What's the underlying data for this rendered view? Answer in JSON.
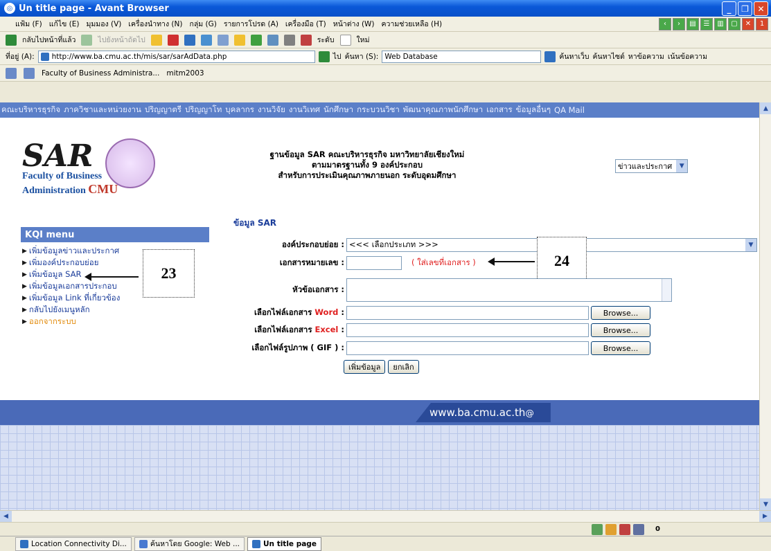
{
  "window": {
    "title": "Un title page - Avant Browser"
  },
  "menu": [
    "แฟ้ม (F)",
    "แก้ไข (E)",
    "มุมมอง (V)",
    "เครื่องนำทาง (N)",
    "กลุ่ม (G)",
    "รายการโปรด (A)",
    "เครื่องมือ (T)",
    "หน้าต่าง (W)",
    "ความช่วยเหลือ (H)"
  ],
  "toolbar": {
    "back": "กลับไปหน้าที่แล้ว",
    "forward": "ไปยังหน้าถัดไป",
    "level": "ระดับ",
    "new": "ใหม่"
  },
  "address": {
    "label": "ที่อยู่ (A):",
    "url": "http://www.ba.cmu.ac.th/mis/sar/sarAdData.php",
    "go": "ไป",
    "search_label": "ค้นหา (S):",
    "search_value": "Web Database",
    "web_search": "ค้นหาเว็บ",
    "site_search": "ค้นหาไซต์",
    "find_text": "หาข้อความ",
    "highlight": "เน้นข้อความ"
  },
  "favorites": [
    "Faculty of Business Administra...",
    "mitm2003"
  ],
  "site_nav": [
    "คณะบริหารธุรกิจ",
    "ภาควิชาและหน่วยงาน",
    "ปริญญาตรี",
    "ปริญญาโท",
    "บุคลากร",
    "งานวิจัย",
    "งานวิเทศ",
    "นักศึกษา",
    "กระบวนวิชา",
    "พัฒนาคุณภาพนักศึกษา",
    "เอกสาร",
    "ข้อมูลอื่นๆ",
    "QA Mail"
  ],
  "logo": {
    "sar": "SAR",
    "line1": "Faculty of Business",
    "line2": "Administration",
    "cmu": "CMU"
  },
  "heading": {
    "line1": "ฐานข้อมูล SAR คณะบริหารธุรกิจ มหาวิทยาลัยเชียงใหม่",
    "line2": "ตามมาตรฐานทั้ง 9 องค์ประกอบ",
    "line3": "สำหรับการประเมินคุณภาพภายนอก ระดับอุดมศึกษา"
  },
  "news_select": "ข่าวและประกาศ",
  "section_title": "ข้อมูล SAR",
  "kqi": {
    "title": "KQI menu",
    "items": [
      "เพิ่มข้อมูลข่าวและประกาศ",
      "เพิ่มองค์ประกอบย่อย",
      "เพิ่มข้อมูล SAR",
      "เพิ่มข้อมูลเอกสารประกอบ",
      "เพิ่มข้อมูล Link ที่เกี่ยวข้อง",
      "กลับไปยังเมนูหลัก",
      "ออกจากระบบ"
    ]
  },
  "form": {
    "component_label": "องค์ประกอบย่อย :",
    "component_value": "<<< เลือกประเภท >>>",
    "docnum_label": "เอกสารหมายเลข :",
    "docnum_hint": "( ใส่เลขที่เอกสาร )",
    "subject_label": "หัวข้อเอกสาร :",
    "word_label": "เลือกไฟล์เอกสาร",
    "word_type": "Word",
    "excel_label": "เลือกไฟล์เอกสาร",
    "excel_type": "Excel",
    "gif_label": "เลือกไฟล์รูปภาพ ( GIF ) :",
    "browse": "Browse...",
    "colon": ":",
    "submit": "เพิ่มข้อมูล",
    "cancel": "ยกเลิก"
  },
  "callouts": {
    "a": "23",
    "b": "24"
  },
  "footer_url": "www.ba.cmu.ac.th",
  "footer_at": "@",
  "status_count": "0",
  "taskbar": [
    "Location Connectivity Di...",
    "ค้นหาโดย Google: Web ...",
    "Un title page"
  ]
}
